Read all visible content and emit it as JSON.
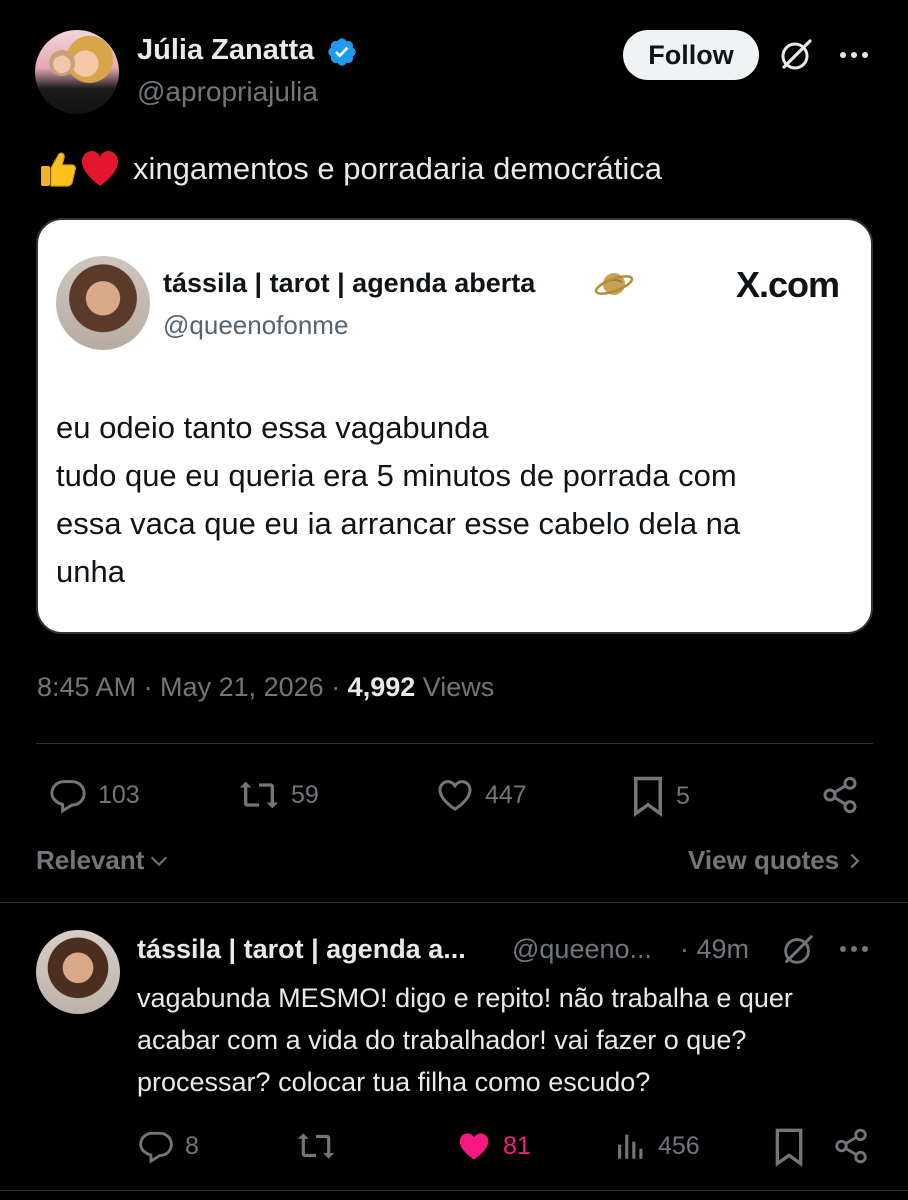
{
  "header": {
    "name": "Júlia Zanatta",
    "handle": "@apropriajulia",
    "follow_label": "Follow"
  },
  "tweet": {
    "text": "xingamentos e porradaria democrática",
    "emojis": [
      "thumbs-up",
      "red-heart"
    ]
  },
  "embedded": {
    "name": "tássila | tarot | agenda aberta",
    "handle": "@queenofonme",
    "source": "X.com",
    "lines": [
      "eu odeio tanto essa vagabunda",
      "tudo que eu queria era 5 minutos de porrada com",
      "essa vaca que eu ia arrancar esse cabelo dela na",
      "unha"
    ]
  },
  "meta": {
    "time": "8:45 AM · May 21, 2026 · ",
    "views_count": "4,992",
    "views_label": " Views"
  },
  "actions": {
    "replies": "103",
    "reposts": "59",
    "likes": "447",
    "bookmarks": "5"
  },
  "sort": {
    "relevant": "Relevant",
    "view_quotes": "View quotes"
  },
  "reply": {
    "name": "tássila | tarot | agenda a...",
    "handle": "@queeno...",
    "time": "· 49m",
    "lines": [
      "vagabunda MESMO! digo e repito! não trabalha e quer",
      "acabar com a vida do trabalhador! vai fazer o que?",
      "processar? colocar tua filha como escudo?"
    ],
    "replies": "8",
    "likes": "81",
    "views": "456"
  },
  "colors": {
    "background": "#000000",
    "text": "#e7e9ea",
    "muted": "#71767b",
    "verified": "#1d9bf0",
    "like_active": "#f91880"
  }
}
